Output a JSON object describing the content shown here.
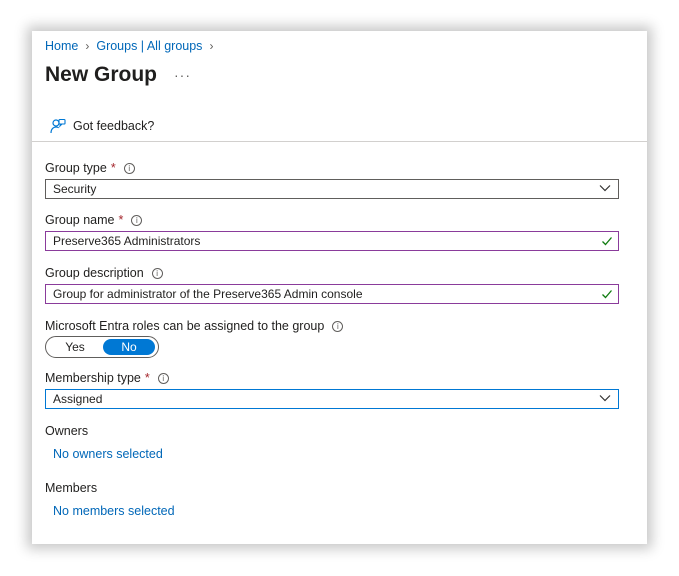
{
  "breadcrumb": {
    "home": "Home",
    "groups": "Groups | All groups"
  },
  "page": {
    "title": "New Group",
    "more": "···"
  },
  "toolbar": {
    "feedback": "Got feedback?"
  },
  "form": {
    "group_type": {
      "label": "Group type",
      "required": "*",
      "value": "Security"
    },
    "group_name": {
      "label": "Group name",
      "required": "*",
      "value": "Preserve365 Administrators"
    },
    "group_description": {
      "label": "Group description",
      "value": "Group for administrator of the Preserve365 Admin console"
    },
    "entra_roles": {
      "label": "Microsoft Entra roles can be assigned to the group",
      "yes": "Yes",
      "no": "No",
      "selected": "No"
    },
    "membership_type": {
      "label": "Membership type",
      "required": "*",
      "value": "Assigned"
    },
    "owners": {
      "label": "Owners",
      "link": "No owners selected"
    },
    "members": {
      "label": "Members",
      "link": "No members selected"
    }
  },
  "colors": {
    "link": "#0067b8",
    "accent": "#0078d4",
    "required": "#a4262c",
    "valid_border": "#8a3b9b",
    "valid_check": "#107c10"
  },
  "icons": [
    "chevron-right-icon",
    "more-icon",
    "feedback-icon",
    "info-icon",
    "chevron-down-icon",
    "checkmark-icon"
  ]
}
